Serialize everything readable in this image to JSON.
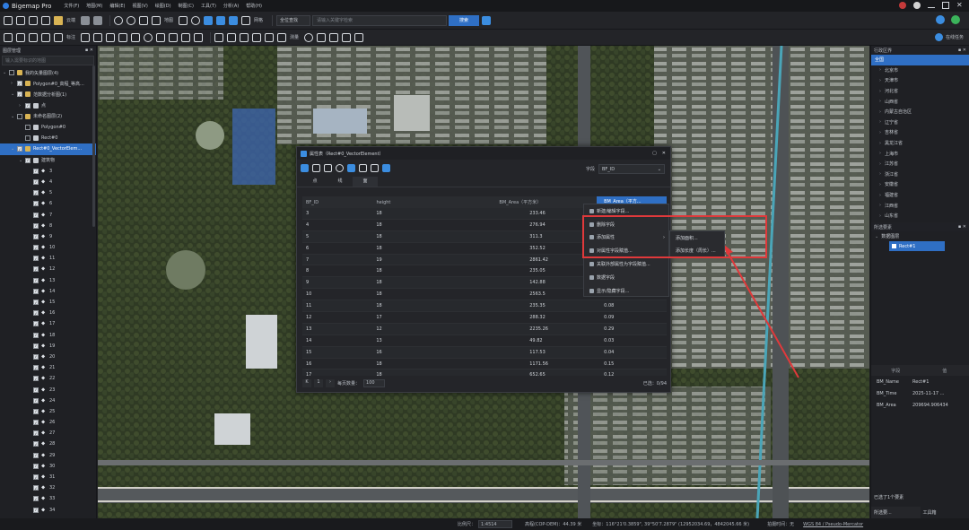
{
  "app": {
    "title": "Bigemap Pro",
    "menus": [
      "文件(F)",
      "地图(M)",
      "编辑(E)",
      "视图(V)",
      "绘图(D)",
      "制图(C)",
      "工具(T)",
      "分析(A)",
      "帮助(H)"
    ]
  },
  "toolbar1": {
    "labels": [
      "云端",
      "地图",
      "网格"
    ],
    "search_mode": "全位查找",
    "search_placeholder": "请输入关键字检索",
    "search_button": "搜索"
  },
  "toolbar2": {
    "labels": [
      "标注",
      "测量"
    ],
    "online_task": "在线任务"
  },
  "left_panel": {
    "title": "图层管理",
    "search_placeholder": "输入需要标识的地图",
    "items": [
      {
        "label": "我的矢量图层(4)",
        "level": 0,
        "arrow": "⌄",
        "cb": false
      },
      {
        "label": "Polygon#0_高程_等高...",
        "level": 1,
        "arrow": "›",
        "cb": true
      },
      {
        "label": "范数据分析图(1)",
        "level": 1,
        "arrow": "⌄",
        "cb": true
      },
      {
        "label": "点",
        "level": 2,
        "arrow": "›",
        "cb": true
      },
      {
        "label": "未命名图层(2)",
        "level": 1,
        "arrow": "⌄",
        "cb": false
      },
      {
        "label": "Polygon#0",
        "level": 2,
        "arrow": "",
        "cb": false
      },
      {
        "label": "Rect#0",
        "level": 2,
        "arrow": "",
        "cb": false
      },
      {
        "label": "Rect#0_VectorElem...",
        "level": 1,
        "arrow": "⌄",
        "cb": true,
        "sel": true
      },
      {
        "label": "建筑物",
        "level": 2,
        "arrow": "⌄",
        "cb": true
      },
      {
        "label": "3",
        "level": 3,
        "pin": true
      },
      {
        "label": "4",
        "level": 3,
        "pin": true
      },
      {
        "label": "5",
        "level": 3,
        "pin": true
      },
      {
        "label": "6",
        "level": 3,
        "pin": true
      },
      {
        "label": "7",
        "level": 3,
        "pin": true
      },
      {
        "label": "8",
        "level": 3,
        "pin": true
      },
      {
        "label": "9",
        "level": 3,
        "pin": true
      },
      {
        "label": "10",
        "level": 3,
        "pin": true
      },
      {
        "label": "11",
        "level": 3,
        "pin": true
      },
      {
        "label": "12",
        "level": 3,
        "pin": true
      },
      {
        "label": "13",
        "level": 3,
        "pin": true
      },
      {
        "label": "14",
        "level": 3,
        "pin": true
      },
      {
        "label": "15",
        "level": 3,
        "pin": true
      },
      {
        "label": "16",
        "level": 3,
        "pin": true
      },
      {
        "label": "17",
        "level": 3,
        "pin": true
      },
      {
        "label": "18",
        "level": 3,
        "pin": true
      },
      {
        "label": "19",
        "level": 3,
        "pin": true
      },
      {
        "label": "20",
        "level": 3,
        "pin": true
      },
      {
        "label": "21",
        "level": 3,
        "pin": true
      },
      {
        "label": "22",
        "level": 3,
        "pin": true
      },
      {
        "label": "23",
        "level": 3,
        "pin": true
      },
      {
        "label": "24",
        "level": 3,
        "pin": true
      },
      {
        "label": "25",
        "level": 3,
        "pin": true
      },
      {
        "label": "26",
        "level": 3,
        "pin": true
      },
      {
        "label": "27",
        "level": 3,
        "pin": true
      },
      {
        "label": "28",
        "level": 3,
        "pin": true
      },
      {
        "label": "29",
        "level": 3,
        "pin": true
      },
      {
        "label": "30",
        "level": 3,
        "pin": true
      },
      {
        "label": "31",
        "level": 3,
        "pin": true
      },
      {
        "label": "32",
        "level": 3,
        "pin": true
      },
      {
        "label": "33",
        "level": 3,
        "pin": true
      },
      {
        "label": "34",
        "level": 3,
        "pin": true
      }
    ]
  },
  "right_panel": {
    "title": "行政区界",
    "regions": [
      "全国",
      "北京市",
      "天津市",
      "河北省",
      "山西省",
      "内蒙古自治区",
      "辽宁省",
      "吉林省",
      "黑龙江省",
      "上海市",
      "江苏省",
      "浙江省",
      "安徽省",
      "福建省",
      "江西省",
      "山东省"
    ],
    "selected_title": "所选要素",
    "selected_group": "数据图层",
    "selected_item": "Rect#1",
    "attr_headers": [
      "字段",
      "值"
    ],
    "attrs": [
      {
        "k": "BM_Name",
        "v": "Rect#1"
      },
      {
        "k": "BM_Time",
        "v": "2025-11-17 ..."
      },
      {
        "k": "BM_Area",
        "v": "209694.906434"
      }
    ],
    "footer_count": "已选了1个要素",
    "tabs": [
      "所选要...",
      "工具箱"
    ]
  },
  "dialog": {
    "title": "属性表（Rect#0_VectorElement）",
    "field_label": "字段",
    "field_value": "BF_ID",
    "tabs": [
      "点",
      "线",
      "面"
    ],
    "headers": [
      "BF_ID",
      "height",
      "BM_Area（平方米）",
      "BM_Area（平方..."
    ],
    "rows": [
      [
        "3",
        "18",
        "233.46",
        "0.07"
      ],
      [
        "4",
        "18",
        "276.94",
        "0.08"
      ],
      [
        "5",
        "18",
        "311.3",
        "0.07"
      ],
      [
        "6",
        "18",
        "352.52",
        "0.08"
      ],
      [
        "7",
        "19",
        "2861.42",
        "0.33"
      ],
      [
        "8",
        "18",
        "235.05",
        "0.08"
      ],
      [
        "9",
        "18",
        "142.88",
        "0.05"
      ],
      [
        "10",
        "18",
        "2563.5",
        "0.33"
      ],
      [
        "11",
        "18",
        "235.35",
        "0.08"
      ],
      [
        "12",
        "17",
        "288.32",
        "0.09"
      ],
      [
        "13",
        "12",
        "2235.26",
        "0.29"
      ],
      [
        "14",
        "13",
        "49.82",
        "0.03"
      ],
      [
        "15",
        "16",
        "117.53",
        "0.04"
      ],
      [
        "16",
        "18",
        "1171.56",
        "0.15"
      ],
      [
        "17",
        "18",
        "652.65",
        "0.12"
      ]
    ],
    "footer": {
      "page": "1",
      "per_page_label": "每页数量：",
      "per_page": "100",
      "selected": "已选：0/94"
    }
  },
  "context_menu": {
    "items": [
      "新建/编辑字段...",
      "删除字段",
      "添加属性",
      "对属性字段赋值...",
      "关联外部属性为字段赋值...",
      "数据字段",
      "显示/隐藏字段..."
    ],
    "submenu": [
      "添加面积...",
      "添加长度（周长）..."
    ]
  },
  "status": {
    "scale_label": "比例尺：",
    "scale": "1:4514",
    "elevation": "高程(COP-DEM)：44.39 米",
    "coords": "坐标：116°21'0.3859\", 39°50'7.2879\" (12952034.69，4842045.66 米)",
    "time": "拍摄时间：无",
    "crs": "WGS 84 / Pseudo-Mercator"
  },
  "colors": {
    "accent": "#2f6fc4",
    "highlight": "#e0393b"
  }
}
